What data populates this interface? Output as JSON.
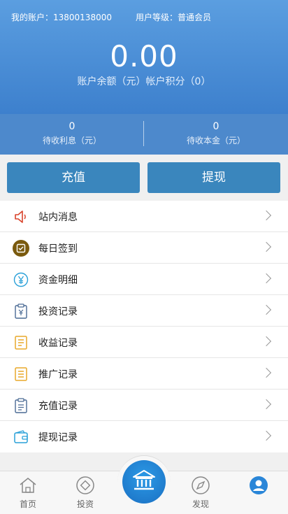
{
  "header": {
    "account_label": "我的账户：13800138000",
    "level_label": "用户等级：普通会员",
    "balance": "0.00",
    "balance_sub": "账户余额（元）帐户积分（0）"
  },
  "stats": [
    {
      "value": "0",
      "label": "待收利息（元）"
    },
    {
      "value": "0",
      "label": "待收本金（元）"
    }
  ],
  "actions": {
    "recharge": "充值",
    "withdraw": "提现"
  },
  "menu": [
    {
      "label": "站内消息",
      "icon": "speaker-icon"
    },
    {
      "label": "每日签到",
      "icon": "checkin-icon"
    },
    {
      "label": "资金明细",
      "icon": "yuan-icon"
    },
    {
      "label": "投资记录",
      "icon": "clipboard-yuan-icon"
    },
    {
      "label": "收益记录",
      "icon": "document-icon"
    },
    {
      "label": "推广记录",
      "icon": "notepad-icon"
    },
    {
      "label": "充值记录",
      "icon": "clipboard-icon"
    },
    {
      "label": "提现记录",
      "icon": "wallet-icon"
    }
  ],
  "nav": {
    "home": "首页",
    "invest": "投资",
    "discover": "发现"
  },
  "colors": {
    "header": "#4a8fd8",
    "button": "#3a86bd",
    "center": "#1a6fc2"
  }
}
